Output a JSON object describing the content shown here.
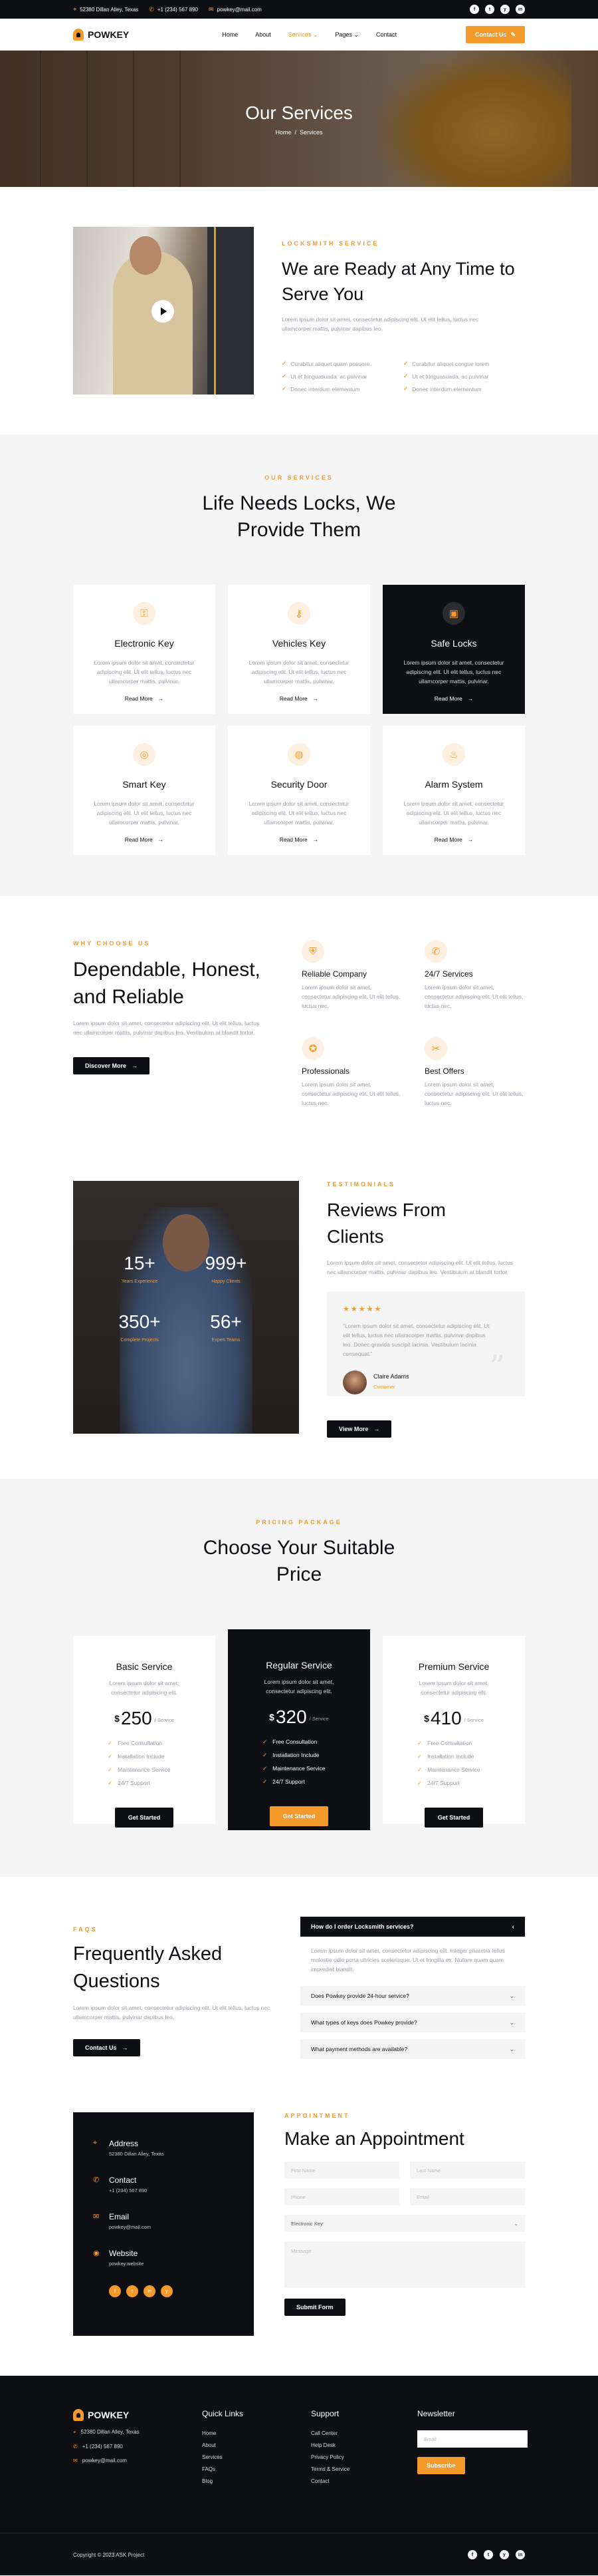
{
  "topbar": {
    "address": "52380 Dillan Alley, Texas",
    "phone": "+1 (234) 567 890",
    "email": "powkey@mail.com",
    "social": [
      "f",
      "t",
      "y",
      "in"
    ]
  },
  "nav": {
    "brand": "POWKEY",
    "menu": [
      "Home",
      "About",
      "Services",
      "Pages",
      "Contact"
    ],
    "active": "Services",
    "cta": "Contact Us"
  },
  "hero": {
    "title": "Our Services",
    "breadcrumb": [
      "Home",
      "Services"
    ]
  },
  "about": {
    "eyebrow": "LOCKSMITH SERVICE",
    "title": "We are Ready at Any Time to Serve You",
    "text": "Lorem ipsum dolor sit amet, consectetur adipiscing elit. Ut elit tellus, luctus nec ullamcorper mattis, pulvinar dapibus leo.",
    "checks": [
      "Curabitur aliquet quam posuere",
      "Curabitur aliquet congue lorem",
      "Ut et fringuasuada. ac pulvinar",
      "Ut et fringuasuada. ac pulvinar",
      "Donec interdum elementum",
      "Donec interdum elementum"
    ]
  },
  "services": {
    "eyebrow": "OUR SERVICES",
    "title": "Life Needs Locks, We Provide Them",
    "items": [
      {
        "title": "Electronic Key",
        "text": "Lorem ipsum dolor sit amet, consectetur adipiscing elit. Ut elit tellus, luctus nec ullamcorper mattis, pulvinar.",
        "link": "Read More",
        "icon": "key-icon"
      },
      {
        "title": "Vehicles Key",
        "text": "Lorem ipsum dolor sit amet, consectetur adipiscing elit. Ut elit tellus, luctus nec ullamcorper mattis, pulvinar.",
        "link": "Read More",
        "icon": "car-key-icon"
      },
      {
        "title": "Safe Locks",
        "text": "Lorem ipsum dolor sit amet, consectetur adipiscing elit. Ut elit tellus, luctus nec ullamcorper mattis, pulvinar.",
        "link": "Read More",
        "icon": "padlock-icon"
      },
      {
        "title": "Smart Key",
        "text": "Lorem ipsum dolor sit amet, consectetur adipiscing elit. Ut elit tellus, luctus nec ullamcorper mattis, pulvinar.",
        "link": "Read More",
        "icon": "smart-key-icon"
      },
      {
        "title": "Security Door",
        "text": "Lorem ipsum dolor sit amet, consectetur adipiscing elit. Ut elit tellus, luctus nec ullamcorper mattis, pulvinar.",
        "link": "Read More",
        "icon": "door-icon"
      },
      {
        "title": "Alarm System",
        "text": "Lorem ipsum dolor sit amet, consectetur adipiscing elit. Ut elit tellus, luctus nec ullamcorper mattis, pulvinar.",
        "link": "Read More",
        "icon": "alarm-icon"
      }
    ]
  },
  "why": {
    "eyebrow": "WHY CHOOSE US",
    "title": "Dependable, Honest, and Reliable",
    "text": "Lorem ipsum dolor sit amet, consectetur adipiscing elit. Ut elit tellus, luctus nec ullamcorper mattis, pulvinar dapibus leo. Vestibulum at blandit tortor.",
    "cta": "Discover More",
    "features": [
      {
        "title": "Reliable Company",
        "text": "Lorem ipsum dolor sit amet, consectetur adipiscing elit. Ut elit tellus, luctus nec.",
        "icon": "shield-icon"
      },
      {
        "title": "24/7 Services",
        "text": "Lorem ipsum dolor sit amet, consectetur adipiscing elit. Ut elit tellus, luctus nec.",
        "icon": "phone-icon"
      },
      {
        "title": "Professionals",
        "text": "Lorem ipsum dolor sit amet, consectetur adipiscing elit. Ut elit tellus, luctus nec.",
        "icon": "badge-icon"
      },
      {
        "title": "Best Offers",
        "text": "Lorem ipsum dolor sit amet, consectetur adipiscing elit. Ut elit tellus, luctus nec.",
        "icon": "tag-icon"
      }
    ]
  },
  "testimonials": {
    "stats": [
      {
        "value": "15+",
        "label": "Years Experience"
      },
      {
        "value": "999+",
        "label": "Happy Clients"
      },
      {
        "value": "350+",
        "label": "Complete Projects"
      },
      {
        "value": "56+",
        "label": "Expert Teams"
      }
    ],
    "eyebrow": "TESTIMONIALS",
    "title": "Reviews From Clients",
    "text": "Lorem ipsum dolor sit amet, consectetur adipiscing elit. Ut elit tellus, luctus nec ullamcorper mattis, pulvinar dapibus leo. Vestibulum at blandit tortor.",
    "stars": "★★★★★",
    "quote": "“Lorem ipsum dolor sit amet, consectetur adipiscing elit. Ut elit tellus, luctus nec ullamcorper mattis, pulvinar dapibus leo. Donec gravida suscipit lacinia. Vestibulum lacinia consequat.”",
    "author": "Claire Adams",
    "role": "Customer",
    "cta": "View More"
  },
  "pricing": {
    "eyebrow": "PRICING PACKAGE",
    "title": "Choose Your Suitable Price",
    "plans": [
      {
        "name": "Basic Service",
        "text": "Lorem ipsum dolor sit amet, consectetur adipiscing elit.",
        "currency": "$",
        "price": "250",
        "per": "/ Service",
        "features": [
          "Free Consultation",
          "Installation Include",
          "Maintenance Service",
          "24/7 Support"
        ],
        "cta": "Get Started"
      },
      {
        "name": "Regular Service",
        "text": "Lorem ipsum dolor sit amet, consectetur adipiscing elit.",
        "currency": "$",
        "price": "320",
        "per": "/ Service",
        "features": [
          "Free Consultation",
          "Installation Include",
          "Maintenance Service",
          "24/7 Support"
        ],
        "cta": "Get Started"
      },
      {
        "name": "Premium Service",
        "text": "Lorem ipsum dolor sit amet, consectetur adipiscing elit.",
        "currency": "$",
        "price": "410",
        "per": "/ Service",
        "features": [
          "Free Consultation",
          "Installation Include",
          "Maintenance Service",
          "24/7 Support"
        ],
        "cta": "Get Started"
      }
    ]
  },
  "faq": {
    "eyebrow": "FAQS",
    "title": "Frequently Asked Questions",
    "text": "Lorem ipsum dolor sit amet, consectetur adipiscing elit. Ut elit tellus, luctus nec ullamcorper mattis, pulvinar dapibus leo.",
    "cta": "Contact Us",
    "open_question": "How do I order Locksmith services?",
    "open_answer": "Lorem ipsum dolor sit amet, consectetur adipiscing elit. Integer pharetra tellus molestie odio porta ultricies scelerisque. Ut et fringilla ex. Nullam quam quam imperdiet blandit.",
    "questions": [
      "Does Powkey provide 24-hour service?",
      "What types of keys does Powkey provide?",
      "What payment methods are available?"
    ]
  },
  "appointment": {
    "contact": [
      {
        "title": "Address",
        "value": "52380 Dillan Alley, Texas",
        "icon": "location-icon"
      },
      {
        "title": "Contact",
        "value": "+1 (234) 567 890",
        "icon": "phone-icon"
      },
      {
        "title": "Email",
        "value": "powkey@mail.com",
        "icon": "mail-icon"
      },
      {
        "title": "Website",
        "value": "powkey.website",
        "icon": "globe-icon"
      }
    ],
    "social": [
      "f",
      "t",
      "in",
      "y"
    ],
    "eyebrow": "APPOINTMENT",
    "title": "Make an Appointment",
    "placeholders": {
      "first": "First Name",
      "last": "Last Name",
      "phone": "Phone",
      "email": "Email",
      "message": "Message"
    },
    "service_value": "Electronic Key",
    "submit": "Submit Form"
  },
  "footer": {
    "brand": "POWKEY",
    "address": "52380 Dillan Alley, Texas",
    "phone": "+1 (234) 567 890",
    "email": "powkey@mail.com",
    "quick_title": "Quick Links",
    "quick": [
      "Home",
      "About",
      "Services",
      "FAQs",
      "Blog"
    ],
    "support_title": "Support",
    "support": [
      "Call Center",
      "Help Desk",
      "Privacy Policy",
      "Terms & Service",
      "Contact"
    ],
    "newsletter_title": "Newsletter",
    "newsletter_placeholder": "Email",
    "subscribe": "Subscribe",
    "copyright": "Copyright © 2023 ASK Project",
    "social": [
      "f",
      "t",
      "y",
      "in"
    ]
  },
  "colors": {
    "accent": "#f39a2b",
    "dark": "#0d0f12",
    "light_bg": "#f5f5f5"
  }
}
